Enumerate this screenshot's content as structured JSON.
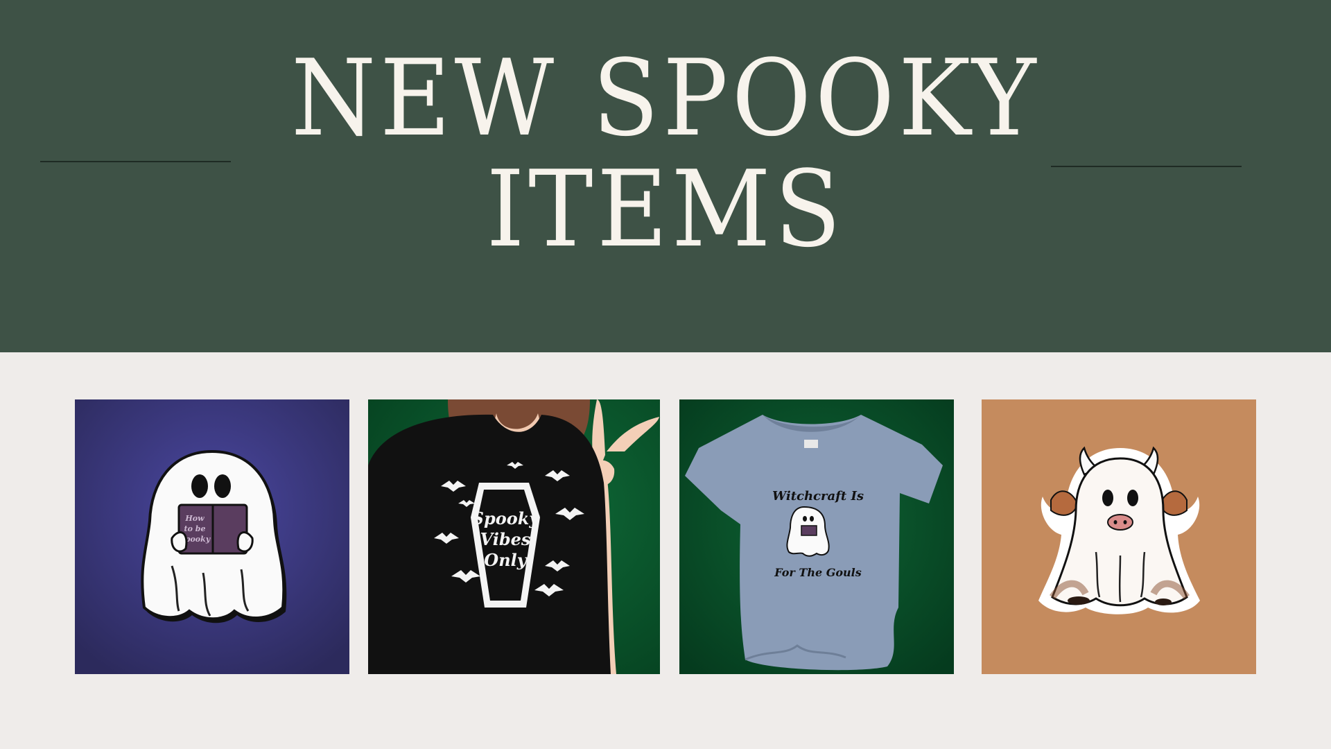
{
  "banner": {
    "title_line_1": "NEW SPOOKY",
    "title_line_2": "ITEMS",
    "background": "#3e5246"
  },
  "products": [
    {
      "name": "ghost-reading-book-pin",
      "background": "#3c3a78",
      "book_text_1": "How",
      "book_text_2": "to be",
      "book_text_3": "Spooky"
    },
    {
      "name": "spooky-vibes-only-tshirt",
      "background": "#0b5a30",
      "shirt_text_1": "Spooky",
      "shirt_text_2": "Vibes",
      "shirt_text_3": "Only"
    },
    {
      "name": "witchcraft-ghost-tshirt",
      "background": "#0b4f2c",
      "shirt_text_top": "Witchcraft Is",
      "shirt_text_bottom": "For The Gouls"
    },
    {
      "name": "ghost-cow-sticker",
      "background": "#c58b5e"
    }
  ]
}
